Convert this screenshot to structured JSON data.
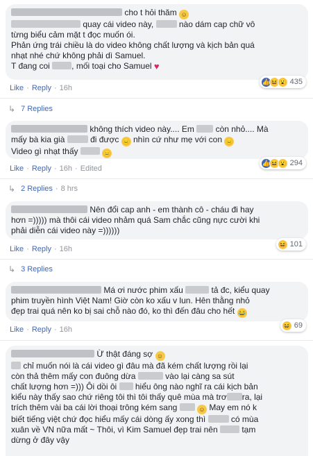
{
  "comments": [
    {
      "line1_after": "cho t hỏi thăm",
      "line2_after1": "quay cái video này,",
      "line2_after2": "nào dám cap chữ vô",
      "line3": "từng biểu cảm mặt t đọc muốn ói.",
      "line4": "Phản ứng trái chiều là do video không chất lượng và kịch bản quá",
      "line5": "nhạt nhé chứ không phải dì Samuel.",
      "line6_before": "T đang coi",
      "line6_after": ", mối toại cho Samuel",
      "reaction_count": "435",
      "like": "Like",
      "reply": "Reply",
      "time": "16h",
      "replies_label": "7 Replies"
    },
    {
      "line1_after1": "không thích video này.... Em",
      "line1_after2": "còn nhỏ.... Mà",
      "line2_before": "mấy bà kia già",
      "line2_mid": "đi được",
      "line2_after": "nhìn cứ như mẹ với con",
      "line3": "Video gì nhạt thấy",
      "reaction_count": "294",
      "like": "Like",
      "reply": "Reply",
      "time": "16h",
      "edited": "Edited",
      "replies_label": "2 Replies",
      "replies_time": "8 hrs"
    },
    {
      "line1_after": "Nên đổi cap anh - em thành cô - cháu đi hay",
      "line2": "hơn =))))) mà thôi cái video nhảm quá Sam chắc cũng nực cười khi",
      "line3": "phải diễn cái video này =))))))",
      "reaction_count": "101",
      "like": "Like",
      "reply": "Reply",
      "time": "16h",
      "replies_label": "3 Replies"
    },
    {
      "line1_after1": "Má ơi nước phim xấu",
      "line1_after2": "tả đc, kiểu quay",
      "line2": "phim truyền hình Việt Nam! Giờ còn ko xấu v lun. Hên thằng nhỏ",
      "line3": "đẹp trai quá nên ko bị sai chỗ nào đó, ko thì đến đâu cho hết",
      "reaction_count": "69",
      "like": "Like",
      "reply": "Reply",
      "time": "16h"
    },
    {
      "line1_after": "Ừ thật đáng sợ",
      "line2": "chỉ muốn nói là cái video gì đâu mà đã kém chất lượng rồi lại",
      "line3_before": "còn thả thêm mấy con đuông dừa",
      "line3_after": "vào lại càng sa sút",
      "line4_before": "chất lượng hơn =))) Ôi dồi ôi",
      "line4_after": "hiểu ông nào nghĩ ra cái kịch bản",
      "line5_before": "kiểu này thấy sao chứ riêng tôi thì tôi thấy quê mùa mà trơ",
      "line5_after": "ra, lại",
      "line6": "trích thêm vài ba cái lời thoại trông kém sang",
      "line6_after": "May em nó k",
      "line7_before": "biết tiếng việt chứ đọc hiểu mấy cái dòng ấy xong thì",
      "line7_after": "có mùa",
      "line8_before": "xuân về VN nữa mất ~ Thôi, vì Kim Samuel đẹp trai nên",
      "line8_after": "tạm",
      "line9": "dừng ở đây vậy"
    }
  ]
}
